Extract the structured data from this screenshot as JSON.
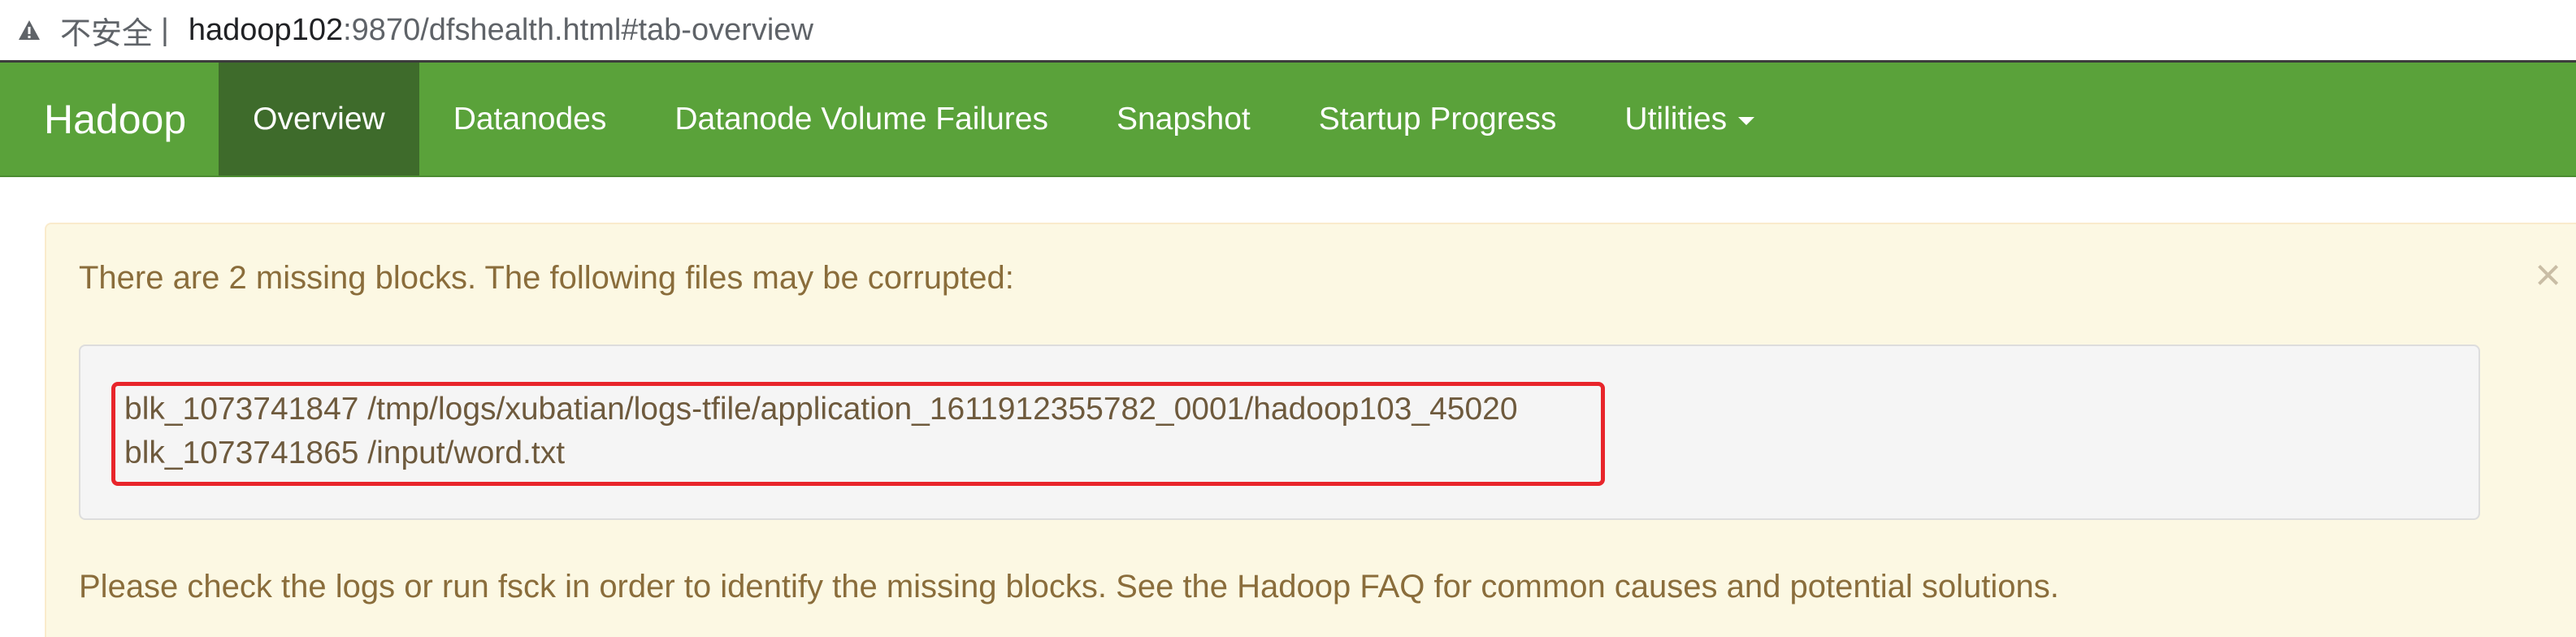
{
  "address_bar": {
    "insecure_label": "不安全",
    "separator": "|",
    "host": "hadoop102",
    "path": ":9870/dfshealth.html#tab-overview"
  },
  "navbar": {
    "brand": "Hadoop",
    "items": [
      {
        "label": "Overview",
        "active": true
      },
      {
        "label": "Datanodes"
      },
      {
        "label": "Datanode Volume Failures"
      },
      {
        "label": "Snapshot"
      },
      {
        "label": "Startup Progress"
      },
      {
        "label": "Utilities"
      }
    ]
  },
  "alert": {
    "message": "There are 2 missing blocks. The following files may be corrupted:",
    "close_symbol": "×",
    "corrupted_files": [
      "blk_1073741847 /tmp/logs/xubatian/logs-tfile/application_1611912355782_0001/hadoop103_45020",
      "blk_1073741865 /input/word.txt"
    ],
    "note": "Please check the logs or run fsck in order to identify the missing blocks. See the Hadoop FAQ for common causes and potential solutions."
  },
  "colors": {
    "navbar": "#5aa23a",
    "navbar_active": "#3e6b2b",
    "alert_bg": "#fcf8e3",
    "alert_text": "#8a6d3b",
    "highlight_border": "#e8252b"
  }
}
